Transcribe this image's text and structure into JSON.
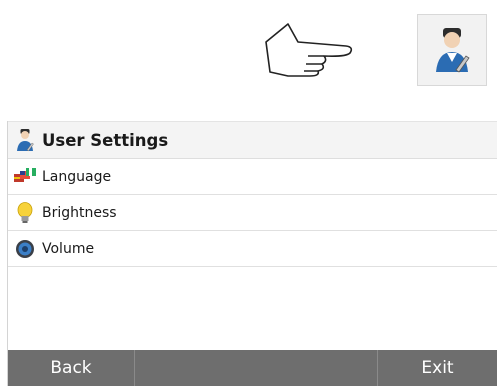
{
  "header": {
    "title": "User Settings",
    "icon": "user-settings-icon"
  },
  "menu": {
    "items": [
      {
        "label": "Language",
        "icon": "flags-icon"
      },
      {
        "label": "Brightness",
        "icon": "lightbulb-icon"
      },
      {
        "label": "Volume",
        "icon": "speaker-icon"
      }
    ]
  },
  "footer": {
    "back_label": "Back",
    "exit_label": "Exit"
  },
  "colors": {
    "footer_bg": "#6e6e6e",
    "header_bg": "#f4f4f4"
  }
}
